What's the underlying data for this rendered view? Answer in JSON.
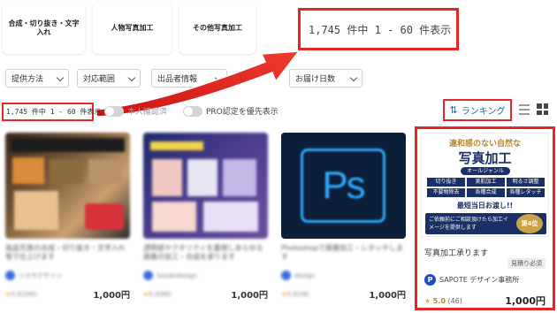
{
  "categories": [
    {
      "label": "合成・切り抜き・文字入れ"
    },
    {
      "label": "人物写真加工"
    },
    {
      "label": "その他写真加工"
    }
  ],
  "callout_text": "1,745 件中 1 - 60 件表示",
  "filters": [
    {
      "label": "提供方法"
    },
    {
      "label": "対応範囲"
    },
    {
      "label": "出品者情報"
    },
    {
      "label": "お届け日数"
    }
  ],
  "result_count": "1,745 件中 1 - 60 件表示",
  "toggles": [
    {
      "label": "本人確認済"
    },
    {
      "label": "PRO認定を優先表示"
    }
  ],
  "sort_label": "ランキング",
  "cards": [
    {
      "title": "商品写真の合成・切り抜き・文字入れ等で仕上げます",
      "seller": "ツカサデザイン",
      "rating": "5.0",
      "reviews": "(295)",
      "price": "1,000円"
    },
    {
      "title": "透明感やクオリティを重視しあらゆる画像の加工・合成を承ります",
      "seller": "Sasakidesign",
      "rating": "5.0",
      "reviews": "(88)",
      "price": "1,000円"
    },
    {
      "title": "Photoshopで画像加工・レタッチします",
      "seller": "design",
      "rating": "5.0",
      "reviews": "(26)",
      "price": "1,000円"
    }
  ],
  "featured": {
    "banner_top": "違和感のない自然な",
    "banner_title": "写真加工",
    "banner_sub": "オールジャンル",
    "tags": [
      "切り抜き",
      "美肌加工",
      "明るさ調整",
      "不要物除去",
      "各種合成",
      "各種レタッチ"
    ],
    "delivery": "最短当日お渡し!!",
    "consult": "ご依頼前にご相談頂けたら加工イメージを提供します",
    "rank_badge": "第4位",
    "title": "写真加工承ります",
    "tag": "見積り必須",
    "seller": "SAPOTE デザイン事務所",
    "rating": "5.0",
    "reviews": "(46)",
    "price": "1,000円"
  },
  "colors": {
    "highlight_red": "#e32626",
    "link_blue": "#1565c0",
    "navy": "#1a2f66"
  }
}
